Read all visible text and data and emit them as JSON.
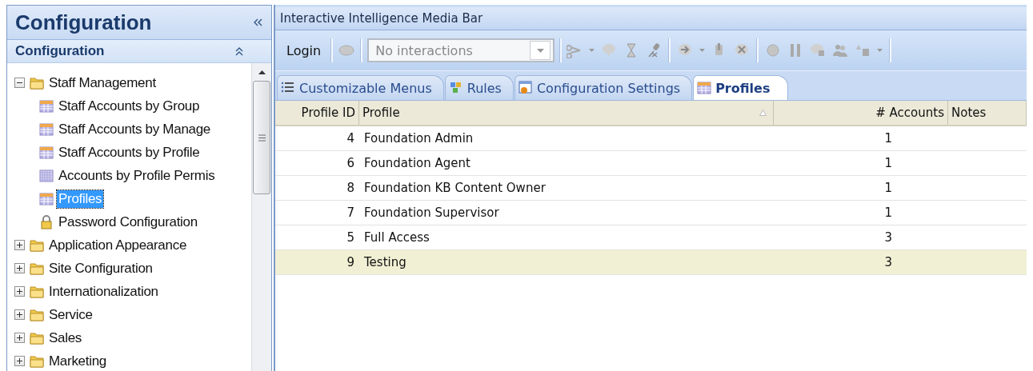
{
  "sidebar": {
    "title": "Configuration",
    "section": {
      "title": "Configuration"
    },
    "tree": [
      {
        "label": "Staff Management",
        "kind": "folder",
        "expanded": true,
        "selected": false,
        "children": [
          {
            "label": "Staff Accounts by Group",
            "kind": "table",
            "selected": false
          },
          {
            "label": "Staff Accounts by Manage",
            "kind": "table",
            "selected": false
          },
          {
            "label": "Staff Accounts by Profile",
            "kind": "table",
            "selected": false
          },
          {
            "label": "Accounts by Profile Permis",
            "kind": "grid",
            "selected": false
          },
          {
            "label": "Profiles",
            "kind": "table",
            "selected": true
          },
          {
            "label": "Password Configuration",
            "kind": "lock",
            "selected": false
          }
        ]
      },
      {
        "label": "Application Appearance",
        "kind": "folder",
        "expanded": false,
        "selected": false
      },
      {
        "label": "Site Configuration",
        "kind": "folder",
        "expanded": false,
        "selected": false
      },
      {
        "label": "Internationalization",
        "kind": "folder",
        "expanded": false,
        "selected": false
      },
      {
        "label": "Service",
        "kind": "folder",
        "expanded": false,
        "selected": false
      },
      {
        "label": "Sales",
        "kind": "folder",
        "expanded": false,
        "selected": false
      },
      {
        "label": "Marketing",
        "kind": "folder",
        "expanded": false,
        "selected": false
      }
    ]
  },
  "media_bar": {
    "title": "Interactive Intelligence Media Bar",
    "login": "Login",
    "interactions": {
      "value": "No interactions"
    }
  },
  "tabs": [
    {
      "label": "Customizable Menus",
      "kind": "list",
      "selected": false
    },
    {
      "label": "Rules",
      "kind": "cubes",
      "selected": false
    },
    {
      "label": "Configuration Settings",
      "kind": "window",
      "selected": false
    },
    {
      "label": "Profiles",
      "kind": "table",
      "selected": true
    }
  ],
  "table": {
    "columns": [
      "Profile ID",
      "Profile",
      "# Accounts",
      "Notes"
    ],
    "rows": [
      {
        "cells": [
          "4",
          "Foundation Admin",
          "1",
          ""
        ],
        "selected": false
      },
      {
        "cells": [
          "6",
          "Foundation Agent",
          "1",
          ""
        ],
        "selected": false
      },
      {
        "cells": [
          "8",
          "Foundation KB Content Owner",
          "1",
          ""
        ],
        "selected": false
      },
      {
        "cells": [
          "7",
          "Foundation Supervisor",
          "1",
          ""
        ],
        "selected": false
      },
      {
        "cells": [
          "5",
          "Full Access",
          "3",
          ""
        ],
        "selected": false
      },
      {
        "cells": [
          "9",
          "Testing",
          "3",
          ""
        ],
        "selected": true
      }
    ]
  }
}
